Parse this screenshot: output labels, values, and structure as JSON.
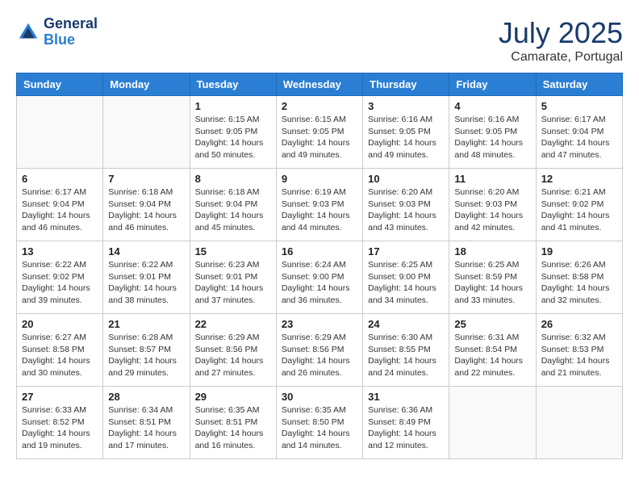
{
  "logo": {
    "line1": "General",
    "line2": "Blue"
  },
  "title": "July 2025",
  "location": "Camarate, Portugal",
  "days_header": [
    "Sunday",
    "Monday",
    "Tuesday",
    "Wednesday",
    "Thursday",
    "Friday",
    "Saturday"
  ],
  "weeks": [
    [
      {
        "day": "",
        "info": ""
      },
      {
        "day": "",
        "info": ""
      },
      {
        "day": "1",
        "info": "Sunrise: 6:15 AM\nSunset: 9:05 PM\nDaylight: 14 hours\nand 50 minutes."
      },
      {
        "day": "2",
        "info": "Sunrise: 6:15 AM\nSunset: 9:05 PM\nDaylight: 14 hours\nand 49 minutes."
      },
      {
        "day": "3",
        "info": "Sunrise: 6:16 AM\nSunset: 9:05 PM\nDaylight: 14 hours\nand 49 minutes."
      },
      {
        "day": "4",
        "info": "Sunrise: 6:16 AM\nSunset: 9:05 PM\nDaylight: 14 hours\nand 48 minutes."
      },
      {
        "day": "5",
        "info": "Sunrise: 6:17 AM\nSunset: 9:04 PM\nDaylight: 14 hours\nand 47 minutes."
      }
    ],
    [
      {
        "day": "6",
        "info": "Sunrise: 6:17 AM\nSunset: 9:04 PM\nDaylight: 14 hours\nand 46 minutes."
      },
      {
        "day": "7",
        "info": "Sunrise: 6:18 AM\nSunset: 9:04 PM\nDaylight: 14 hours\nand 46 minutes."
      },
      {
        "day": "8",
        "info": "Sunrise: 6:18 AM\nSunset: 9:04 PM\nDaylight: 14 hours\nand 45 minutes."
      },
      {
        "day": "9",
        "info": "Sunrise: 6:19 AM\nSunset: 9:03 PM\nDaylight: 14 hours\nand 44 minutes."
      },
      {
        "day": "10",
        "info": "Sunrise: 6:20 AM\nSunset: 9:03 PM\nDaylight: 14 hours\nand 43 minutes."
      },
      {
        "day": "11",
        "info": "Sunrise: 6:20 AM\nSunset: 9:03 PM\nDaylight: 14 hours\nand 42 minutes."
      },
      {
        "day": "12",
        "info": "Sunrise: 6:21 AM\nSunset: 9:02 PM\nDaylight: 14 hours\nand 41 minutes."
      }
    ],
    [
      {
        "day": "13",
        "info": "Sunrise: 6:22 AM\nSunset: 9:02 PM\nDaylight: 14 hours\nand 39 minutes."
      },
      {
        "day": "14",
        "info": "Sunrise: 6:22 AM\nSunset: 9:01 PM\nDaylight: 14 hours\nand 38 minutes."
      },
      {
        "day": "15",
        "info": "Sunrise: 6:23 AM\nSunset: 9:01 PM\nDaylight: 14 hours\nand 37 minutes."
      },
      {
        "day": "16",
        "info": "Sunrise: 6:24 AM\nSunset: 9:00 PM\nDaylight: 14 hours\nand 36 minutes."
      },
      {
        "day": "17",
        "info": "Sunrise: 6:25 AM\nSunset: 9:00 PM\nDaylight: 14 hours\nand 34 minutes."
      },
      {
        "day": "18",
        "info": "Sunrise: 6:25 AM\nSunset: 8:59 PM\nDaylight: 14 hours\nand 33 minutes."
      },
      {
        "day": "19",
        "info": "Sunrise: 6:26 AM\nSunset: 8:58 PM\nDaylight: 14 hours\nand 32 minutes."
      }
    ],
    [
      {
        "day": "20",
        "info": "Sunrise: 6:27 AM\nSunset: 8:58 PM\nDaylight: 14 hours\nand 30 minutes."
      },
      {
        "day": "21",
        "info": "Sunrise: 6:28 AM\nSunset: 8:57 PM\nDaylight: 14 hours\nand 29 minutes."
      },
      {
        "day": "22",
        "info": "Sunrise: 6:29 AM\nSunset: 8:56 PM\nDaylight: 14 hours\nand 27 minutes."
      },
      {
        "day": "23",
        "info": "Sunrise: 6:29 AM\nSunset: 8:56 PM\nDaylight: 14 hours\nand 26 minutes."
      },
      {
        "day": "24",
        "info": "Sunrise: 6:30 AM\nSunset: 8:55 PM\nDaylight: 14 hours\nand 24 minutes."
      },
      {
        "day": "25",
        "info": "Sunrise: 6:31 AM\nSunset: 8:54 PM\nDaylight: 14 hours\nand 22 minutes."
      },
      {
        "day": "26",
        "info": "Sunrise: 6:32 AM\nSunset: 8:53 PM\nDaylight: 14 hours\nand 21 minutes."
      }
    ],
    [
      {
        "day": "27",
        "info": "Sunrise: 6:33 AM\nSunset: 8:52 PM\nDaylight: 14 hours\nand 19 minutes."
      },
      {
        "day": "28",
        "info": "Sunrise: 6:34 AM\nSunset: 8:51 PM\nDaylight: 14 hours\nand 17 minutes."
      },
      {
        "day": "29",
        "info": "Sunrise: 6:35 AM\nSunset: 8:51 PM\nDaylight: 14 hours\nand 16 minutes."
      },
      {
        "day": "30",
        "info": "Sunrise: 6:35 AM\nSunset: 8:50 PM\nDaylight: 14 hours\nand 14 minutes."
      },
      {
        "day": "31",
        "info": "Sunrise: 6:36 AM\nSunset: 8:49 PM\nDaylight: 14 hours\nand 12 minutes."
      },
      {
        "day": "",
        "info": ""
      },
      {
        "day": "",
        "info": ""
      }
    ]
  ]
}
